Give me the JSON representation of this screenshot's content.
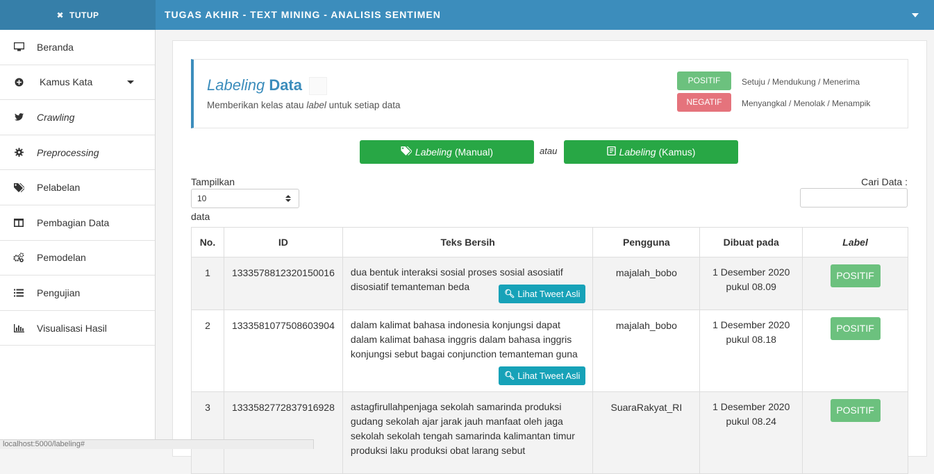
{
  "topbar": {
    "toggle_label": "TUTUP",
    "title": "TUGAS AKHIR - TEXT MINING - ANALISIS SENTIMEN"
  },
  "sidebar": {
    "items": [
      {
        "label": "Beranda",
        "icon": "monitor-icon"
      },
      {
        "label": "Kamus Kata",
        "icon": "plus-circle-icon"
      },
      {
        "label": "Crawling",
        "icon": "twitter-icon"
      },
      {
        "label": "Preprocessing",
        "icon": "gear-icon"
      },
      {
        "label": "Pelabelan",
        "icon": "tags-icon"
      },
      {
        "label": "Pembagian Data",
        "icon": "columns-icon"
      },
      {
        "label": "Pemodelan",
        "icon": "cogs-icon"
      },
      {
        "label": "Pengujian",
        "icon": "list-icon"
      },
      {
        "label": "Visualisasi Hasil",
        "icon": "bar-chart-icon"
      }
    ]
  },
  "header": {
    "title_italic": "Labeling",
    "title_bold": "Data",
    "subtitle_pre": "Memberikan kelas atau",
    "subtitle_italic": "label",
    "subtitle_post": "untuk setiap data",
    "legend": [
      {
        "badge": "POSITIF",
        "text": "Setuju / Mendukung / Menerima",
        "color": "#6cc17e"
      },
      {
        "badge": "NEGATIF",
        "text": "Menyangkal / Menolak / Menampik",
        "color": "#e5737c"
      }
    ]
  },
  "actions": {
    "manual_italic": "Labeling",
    "manual_rest": "(Manual)",
    "atau": "atau",
    "kamus_italic": "Labeling",
    "kamus_rest": "(Kamus)"
  },
  "controls": {
    "show_label": "Tampilkan",
    "page_size": "10",
    "data_label": "data",
    "search_label": "Cari Data :"
  },
  "table": {
    "headers": [
      "No.",
      "ID",
      "Teks Bersih",
      "Pengguna",
      "Dibuat pada",
      "Label"
    ],
    "tweet_button": "Lihat Tweet Asli",
    "rows": [
      {
        "no": "1",
        "id": "1333578812320150016",
        "text": "dua bentuk interaksi sosial proses sosial asosiatif disosiatif temanteman beda",
        "user": "majalah_bobo",
        "date": "1 Desember 2020",
        "time": "pukul 08.09",
        "label": "POSITIF"
      },
      {
        "no": "2",
        "id": "1333581077508603904",
        "text": "dalam kalimat bahasa indonesia konjungsi dapat dalam kalimat bahasa inggris dalam bahasa inggris konjungsi sebut bagai conjunction temanteman guna",
        "user": "majalah_bobo",
        "date": "1 Desember 2020",
        "time": "pukul 08.18",
        "label": "POSITIF"
      },
      {
        "no": "3",
        "id": "1333582772837916928",
        "text": "astagfirullahpenjaga sekolah samarinda produksi gudang sekolah ajar jarak jauh manfaat oleh jaga sekolah sekolah tengah samarinda kalimantan timur produksi laku produksi obat larang sebut",
        "user": "SuaraRakyat_RI",
        "date": "1 Desember 2020",
        "time": "pukul 08.24",
        "label": "POSITIF"
      }
    ]
  },
  "status": {
    "url": "localhost:5000/labeling#"
  }
}
